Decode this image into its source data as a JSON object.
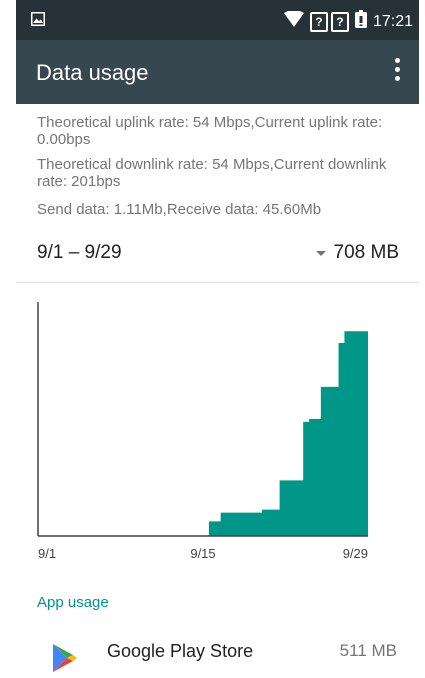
{
  "status_bar": {
    "time": "17:21",
    "sim_slot_1": "?",
    "sim_slot_2": "?",
    "icons": [
      "image-notification-icon",
      "wifi-icon",
      "sim-icon",
      "sim-icon",
      "battery-icon"
    ]
  },
  "app_bar": {
    "title": "Data usage",
    "overflow_icon": "more-vert-icon"
  },
  "info": {
    "uplink": "Theoretical uplink rate: 54 Mbps,Current uplink rate: 0.00bps",
    "downlink": "Theoretical downlink rate: 54 Mbps,Current downlink rate: 201bps",
    "transfer": "Send data: 1.11Mb,Receive data: 45.60Mb"
  },
  "cycle": {
    "range": "9/1 – 9/29",
    "total": "708 MB"
  },
  "chart_data": {
    "type": "area",
    "x_tick_labels": [
      "9/1",
      "9/15",
      "9/29"
    ],
    "x": [
      1,
      15,
      15.5,
      16.5,
      20,
      21.5,
      23.5,
      24,
      25,
      26.5,
      27,
      29
    ],
    "y": [
      0,
      0,
      50,
      80,
      90,
      190,
      390,
      400,
      510,
      660,
      700,
      708
    ],
    "xlim": [
      1,
      29
    ],
    "ylim": [
      0,
      800
    ],
    "unit": "MB",
    "fill_color": "#009688"
  },
  "app_usage": {
    "header": "App usage",
    "items": [
      {
        "name": "Google Play Store",
        "size": "511 MB",
        "icon": "google-play-icon"
      }
    ]
  },
  "colors": {
    "status_bar": "#263238",
    "app_bar": "#37474f",
    "accent": "#009688"
  }
}
